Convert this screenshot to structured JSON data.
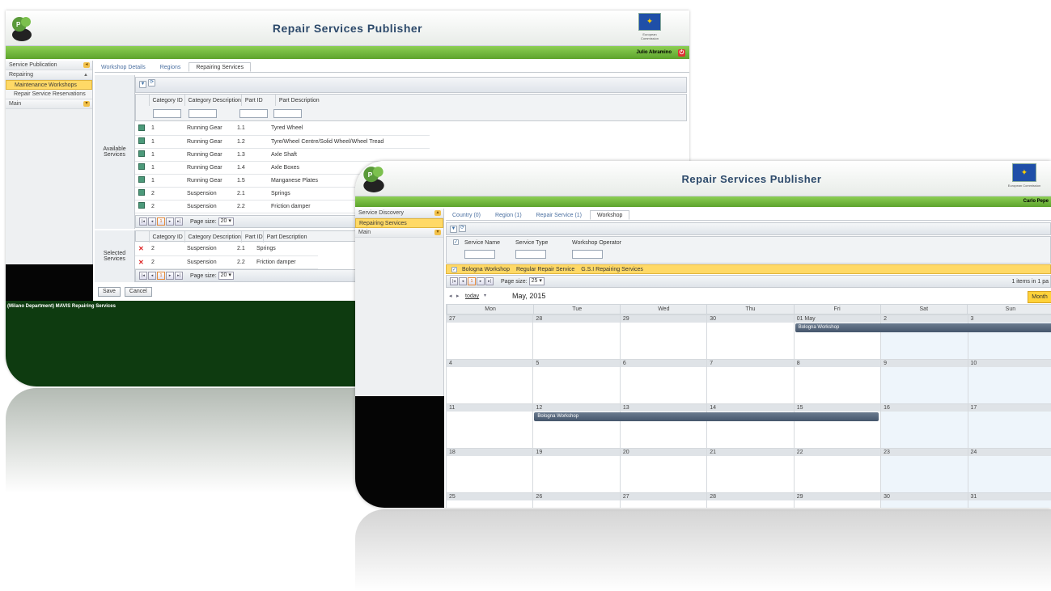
{
  "app_title": "Repair Services Publisher",
  "eu_label": "European Commission",
  "screen1": {
    "user": "Julio Abramino",
    "sidebar": {
      "service_publication": "Service Publication",
      "repairing": "Repairing",
      "maintenance_workshops": "Maintenance Workshops",
      "repair_service_reservations": "Repair Service Reservations",
      "main": "Main"
    },
    "tabs": [
      "Workshop Details",
      "Regions",
      "Repairing Services"
    ],
    "available_label": "Available Services",
    "selected_label": "Selected Services",
    "columns": [
      "Category ID",
      "Category Description",
      "Part ID",
      "Part Description"
    ],
    "available_rows": [
      [
        "1",
        "Running Gear",
        "1.1",
        "Tyred Wheel"
      ],
      [
        "1",
        "Running Gear",
        "1.2",
        "Tyre/Wheel Centre/Solid Wheel/Wheel Tread"
      ],
      [
        "1",
        "Running Gear",
        "1.3",
        "Axle Shaft"
      ],
      [
        "1",
        "Running Gear",
        "1.4",
        "Axle Boxes"
      ],
      [
        "1",
        "Running Gear",
        "1.5",
        "Manganese Plates"
      ],
      [
        "2",
        "Suspension",
        "2.1",
        "Springs"
      ],
      [
        "2",
        "Suspension",
        "2.2",
        "Friction damper"
      ]
    ],
    "selected_rows": [
      [
        "2",
        "Suspension",
        "2.1",
        "Springs"
      ],
      [
        "2",
        "Suspension",
        "2.2",
        "Friction damper"
      ]
    ],
    "page_label": "1",
    "page_size_label": "Page size:",
    "page_size_value": "20",
    "save": "Save",
    "cancel": "Cancel",
    "footer_text": "(Milano Department) MAVIS Repairing Services"
  },
  "screen2": {
    "user": "Carlo Pepe",
    "sidebar": {
      "service_discovery": "Service Discovery",
      "repairing_services": "Repairing Services",
      "main": "Main"
    },
    "tabs": [
      "Country (0)",
      "Region (1)",
      "Repair Service (1)",
      "Workshop"
    ],
    "columns": [
      "Service Name",
      "Service Type",
      "Workshop Operator"
    ],
    "row": [
      "Bologna Workshop",
      "Regular Repair Service",
      "G.S.I Repairing Services"
    ],
    "page_label": "1",
    "page_size_label": "Page size:",
    "page_size_value": "25",
    "items_info": "1 items in 1 pa",
    "today": "today",
    "month_title": "May, 2015",
    "month_button": "Month",
    "weekdays": [
      "Mon",
      "Tue",
      "Wed",
      "Thu",
      "Fri",
      "Sat",
      "Sun"
    ],
    "weeks": [
      [
        "27",
        "28",
        "29",
        "30",
        "01 May",
        "2",
        "3"
      ],
      [
        "4",
        "5",
        "6",
        "7",
        "8",
        "9",
        "10"
      ],
      [
        "11",
        "12",
        "13",
        "14",
        "15",
        "16",
        "17"
      ],
      [
        "18",
        "19",
        "20",
        "21",
        "22",
        "23",
        "24"
      ],
      [
        "25",
        "26",
        "27",
        "28",
        "29",
        "30",
        "31"
      ]
    ],
    "events": [
      "Bologna Workshop",
      "Bologna Workshop"
    ]
  }
}
